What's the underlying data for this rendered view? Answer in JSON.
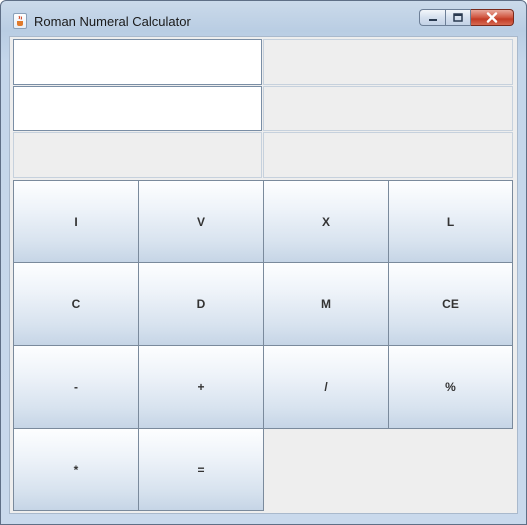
{
  "window": {
    "title": "Roman Numeral Calculator",
    "icon": "java-cup-icon",
    "controls": {
      "minimize": "minimize-icon",
      "maximize": "maximize-icon",
      "close": "close-icon"
    }
  },
  "fields": {
    "input1": "",
    "input2": "",
    "readout1": "",
    "readout2": "",
    "result_left": "",
    "result_right": ""
  },
  "keys": [
    "I",
    "V",
    "X",
    "L",
    "C",
    "D",
    "M",
    "CE",
    "-",
    "+",
    "/",
    "%",
    "*",
    "="
  ],
  "colors": {
    "close_button": "#c23b25",
    "client_bg": "#eeeeee",
    "button_bottom": "#c6d5e6"
  }
}
